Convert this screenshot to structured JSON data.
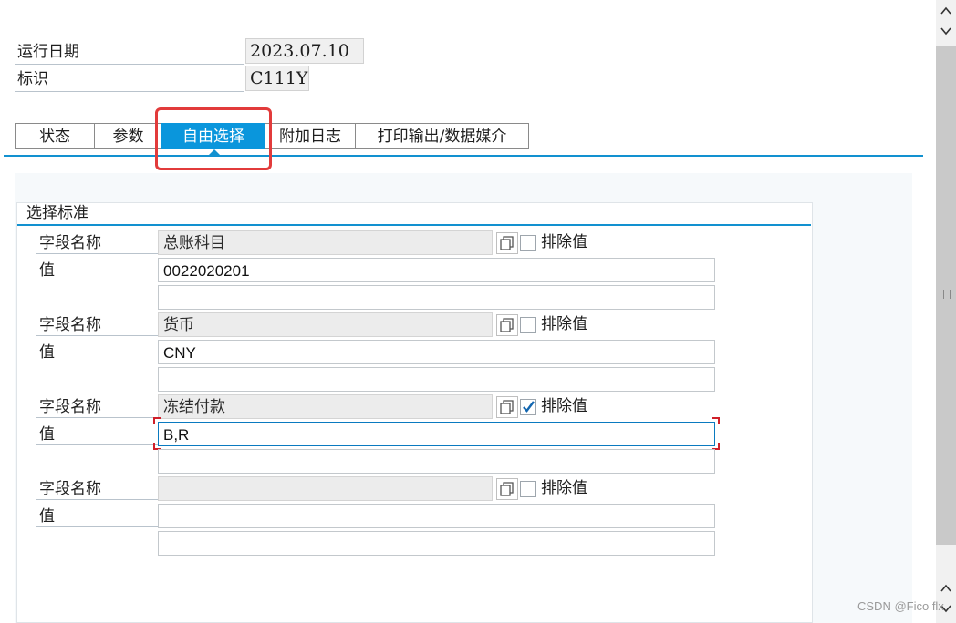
{
  "header": {
    "run_date_label": "运行日期",
    "run_date_value": "2023.07.10",
    "id_label": "标识",
    "id_value": "C111Y"
  },
  "tabs": [
    {
      "label": "状态",
      "active": false
    },
    {
      "label": "参数",
      "active": false
    },
    {
      "label": "自由选择",
      "active": true
    },
    {
      "label": "附加日志",
      "active": false
    },
    {
      "label": "打印输出/数据媒介",
      "active": false
    }
  ],
  "selection": {
    "title": "选择标准",
    "blocks": [
      {
        "field_label": "字段名称",
        "field_name": "总账科目",
        "value_label": "值",
        "value": "0022020201",
        "value2": "",
        "exclude_label": "排除值",
        "exclude_checked": false
      },
      {
        "field_label": "字段名称",
        "field_name": "货币",
        "value_label": "值",
        "value": "CNY",
        "value2": "",
        "exclude_label": "排除值",
        "exclude_checked": false
      },
      {
        "field_label": "字段名称",
        "field_name": "冻结付款",
        "value_label": "值",
        "value": "B,R",
        "value2": "",
        "exclude_label": "排除值",
        "exclude_checked": true
      },
      {
        "field_label": "字段名称",
        "field_name": "",
        "value_label": "值",
        "value": "",
        "value2": "",
        "exclude_label": "排除值",
        "exclude_checked": false
      }
    ]
  },
  "watermark": "CSDN @Fico flx",
  "colors": {
    "accent": "#0a96dc",
    "highlight": "#e23b3b"
  }
}
